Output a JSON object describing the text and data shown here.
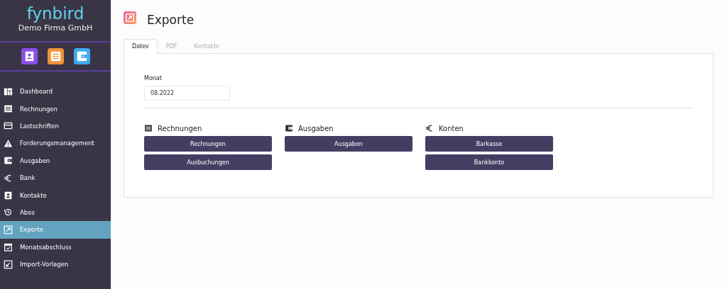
{
  "brand": {
    "logo": "fynbird",
    "company": "Demo Firma GmbH"
  },
  "quick_apps": [
    {
      "kind": "contact",
      "color": "#8b4fe8"
    },
    {
      "kind": "invoice",
      "color": "#f0923a"
    },
    {
      "kind": "wallet",
      "color": "#3fa9f0"
    }
  ],
  "sidebar": {
    "items": [
      {
        "label": "Dashboard",
        "kind": "dashboard",
        "selected": false
      },
      {
        "label": "Rechnungen",
        "kind": "invoice",
        "selected": false
      },
      {
        "label": "Lastschriften",
        "kind": "card",
        "selected": false
      },
      {
        "label": "Forderungsmanagement",
        "kind": "warning",
        "selected": false
      },
      {
        "label": "Ausgaben",
        "kind": "wallet",
        "selected": false
      },
      {
        "label": "Bank",
        "kind": "euro",
        "selected": false
      },
      {
        "label": "Kontakte",
        "kind": "contact",
        "selected": false
      },
      {
        "label": "Abos",
        "kind": "history",
        "selected": false
      },
      {
        "label": "Exporte",
        "kind": "export",
        "selected": true
      },
      {
        "label": "Monatsabschluss",
        "kind": "calendar",
        "selected": false
      },
      {
        "label": "Import-Vorlagen",
        "kind": "import",
        "selected": false
      }
    ]
  },
  "page": {
    "title": "Exporte"
  },
  "tabs": [
    {
      "label": "Datev",
      "selected": true
    },
    {
      "label": "PDF",
      "selected": false
    },
    {
      "label": "Kontakte",
      "selected": false
    }
  ],
  "month_field": {
    "label": "Monat",
    "value": "08.2022"
  },
  "sections": [
    {
      "title": "Rechnungen",
      "kind": "invoice",
      "buttons": [
        "Rechnungen",
        "Ausbuchungen"
      ]
    },
    {
      "title": "Ausgaben",
      "kind": "wallet",
      "buttons": [
        "Ausgaben"
      ]
    },
    {
      "title": "Konten",
      "kind": "euro",
      "buttons": [
        "Barkasse",
        "Bankkonto"
      ]
    }
  ]
}
